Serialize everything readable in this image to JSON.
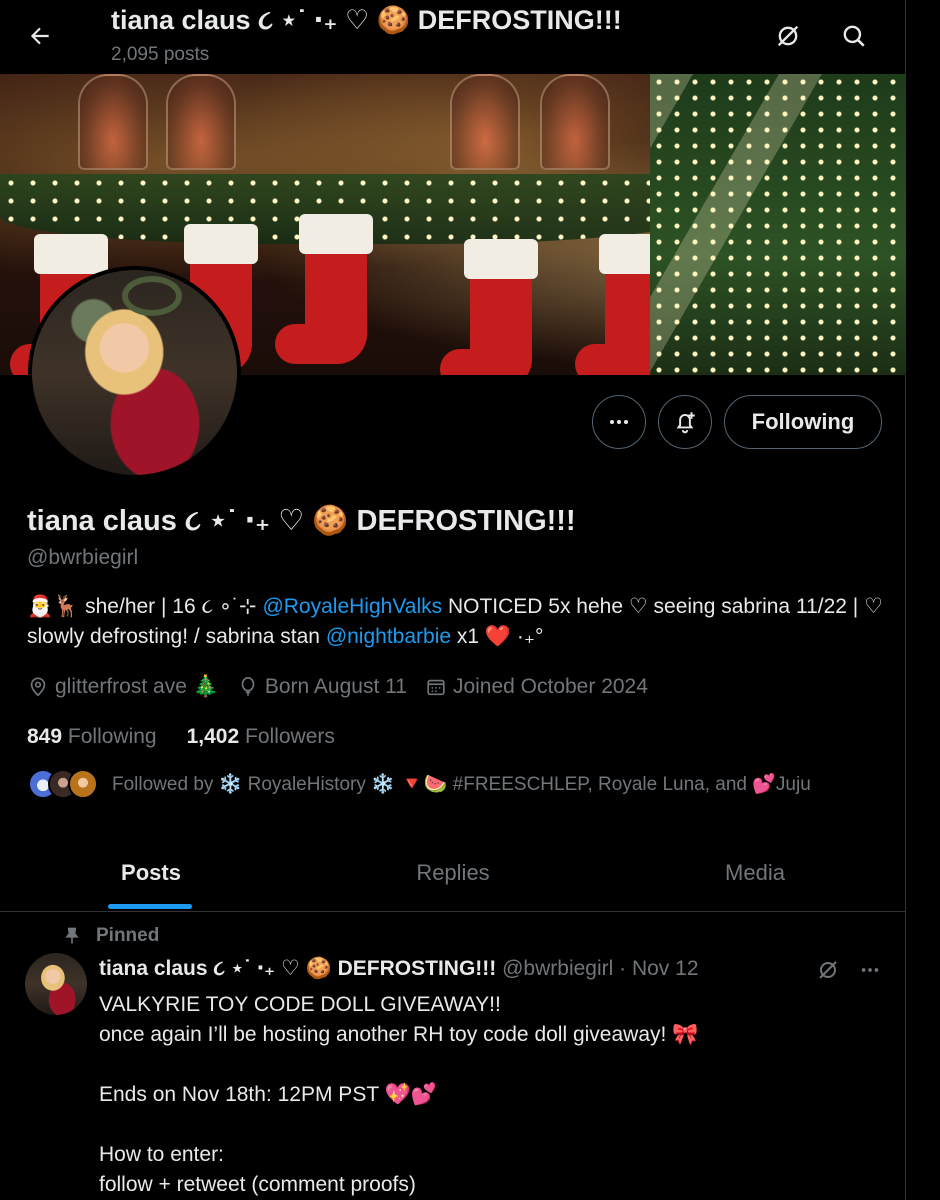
{
  "header": {
    "title": "tiana claus ૮ ⋆˙ ‧₊ ♡ 🍪 DEFROSTING!!!",
    "post_count": "2,095 posts",
    "back_icon": "arrow-left-icon",
    "grok_icon": "grok-icon",
    "search_icon": "search-icon"
  },
  "actions": {
    "more_icon": "more-icon",
    "notify_icon": "bell-plus-icon",
    "following_label": "Following"
  },
  "profile": {
    "display_name": "tiana claus ૮ ⋆˙ ‧₊ ♡ 🍪 DEFROSTING!!!",
    "handle": "@bwrbiegirl",
    "bio": {
      "part1": "🎅🦌 she/her | 16 ૮ ∘˙⊹ ",
      "mention1": "@RoyaleHighValks",
      "part2": " NOTICED 5x hehe ♡ seeing sabrina 11/22 | ♡ slowly defrosting! / sabrina stan ",
      "mention2": "@nightbarbie",
      "part3": " x1 ❤️ ·₊°"
    },
    "location": "glitterfrost ave 🎄",
    "birthday": "Born August 11",
    "joined": "Joined October 2024",
    "following_count": "849",
    "following_label": "Following",
    "followers_count": "1,402",
    "followers_label": "Followers",
    "followed_by": "Followed by ❄️ RoyaleHistory ❄️ 🔻🍉 #FREESCHLEP, Royale Luna, and 💕Juju"
  },
  "tabs": [
    {
      "label": "Posts"
    },
    {
      "label": "Replies"
    },
    {
      "label": "Media"
    }
  ],
  "pinned_post": {
    "pinned_label": "Pinned",
    "author_name": "tiana claus ૮ ⋆˙ ‧₊ ♡ 🍪 DEFROSTING!!!",
    "author_handle_date": "@bwrbiegirl · Nov 12",
    "text": "VALKYRIE TOY CODE DOLL GIVEAWAY!!\nonce again I’ll be hosting another RH toy code doll giveaway! 🎀\n\nEnds on Nov 18th: 12PM PST 💖💕\n\nHow to enter:\nfollow + retweet (comment proofs)"
  },
  "colors": {
    "background": "#000000",
    "text": "#e7e9ea",
    "muted": "#71767b",
    "accent": "#1d9bf0",
    "border": "#2f3336"
  }
}
